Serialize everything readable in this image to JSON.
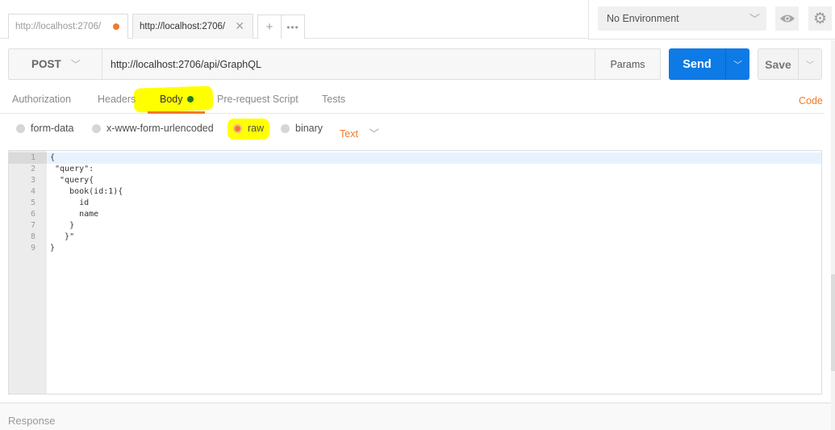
{
  "tabs": [
    {
      "label": "http://localhost:2706/",
      "state": "unsaved-changes",
      "active": false
    },
    {
      "label": "http://localhost:2706/",
      "state": "normal",
      "active": true
    }
  ],
  "tab_actions": {
    "new_tab": "+",
    "more": "•••"
  },
  "environment": {
    "selected": "No Environment"
  },
  "request": {
    "method": "POST",
    "url": "http://localhost:2706/api/GraphQL",
    "params_label": "Params",
    "send_label": "Send",
    "save_label": "Save"
  },
  "request_tabs": [
    {
      "label": "Authorization",
      "active": false
    },
    {
      "label": "Headers",
      "active": false
    },
    {
      "label": "Body",
      "active": true,
      "indicator": true
    },
    {
      "label": "Pre-request Script",
      "active": false
    },
    {
      "label": "Tests",
      "active": false
    }
  ],
  "code_link": "Code",
  "body_types": [
    {
      "label": "form-data",
      "selected": false
    },
    {
      "label": "x-www-form-urlencoded",
      "selected": false
    },
    {
      "label": "raw",
      "selected": true
    },
    {
      "label": "binary",
      "selected": false
    }
  ],
  "content_type": "Text",
  "editor": {
    "lines": [
      {
        "n": "1",
        "text": "{"
      },
      {
        "n": "2",
        "text": " \"query\":"
      },
      {
        "n": "3",
        "text": "  \"query{"
      },
      {
        "n": "4",
        "text": "    book(id:1){"
      },
      {
        "n": "5",
        "text": "      id"
      },
      {
        "n": "6",
        "text": "      name"
      },
      {
        "n": "7",
        "text": "    }"
      },
      {
        "n": "8",
        "text": "   }\""
      },
      {
        "n": "9",
        "text": "}"
      }
    ]
  },
  "response": {
    "label": "Response"
  },
  "colors": {
    "accent": "#f07a2a",
    "send": "#0d7ae5",
    "highlight": "#ffff00",
    "body_indicator": "#1d7a2c"
  }
}
